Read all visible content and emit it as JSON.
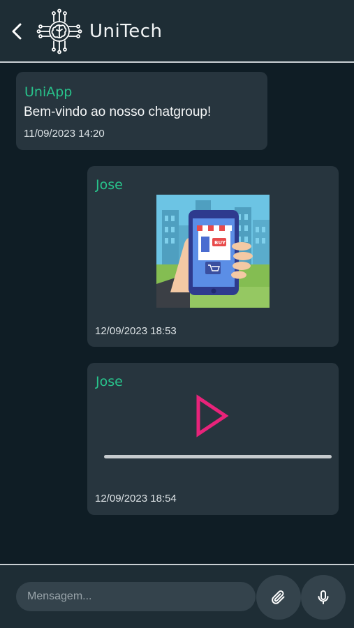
{
  "header": {
    "title": "UniTech",
    "icons": {
      "back": "chevron-left-icon",
      "logo": "circuit-brain-logo"
    }
  },
  "messages": [
    {
      "sender": "UniApp",
      "type": "text",
      "text": "Bem-vindo ao nosso chatgroup!",
      "time": "11/09/2023 14:20"
    },
    {
      "sender": "Jose",
      "type": "image",
      "image_desc": "hand-holding-phone-shop",
      "image_text": "BUY",
      "time": "12/09/2023 18:53"
    },
    {
      "sender": "Jose",
      "type": "audio",
      "progress": 0,
      "time": "12/09/2023 18:54"
    }
  ],
  "composer": {
    "placeholder": "Mensagem...",
    "value": "",
    "attach_icon": "paperclip-icon",
    "mic_icon": "microphone-icon"
  },
  "colors": {
    "background": "#0f1d25",
    "bar": "#1e2d35",
    "bubble": "#27353e",
    "sender": "#28c48c",
    "play": "#e8237a",
    "input": "#34434c"
  }
}
